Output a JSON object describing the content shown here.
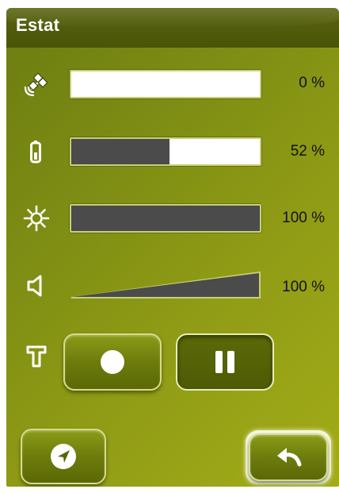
{
  "header": {
    "title": "Estat"
  },
  "rows": [
    {
      "id": "gps",
      "icon": "satellite-icon",
      "percent_label": "0 %",
      "level": 0
    },
    {
      "id": "battery",
      "icon": "battery-icon",
      "percent_label": "52 %",
      "level": 0.52
    },
    {
      "id": "brightness",
      "icon": "brightness-icon",
      "percent_label": "100 %",
      "level": 1.0
    },
    {
      "id": "volume",
      "icon": "speaker-icon",
      "percent_label": "100 %",
      "level": 1.0
    }
  ],
  "track": {
    "icon": "track-t-icon",
    "record_icon": "record-icon",
    "pause_icon": "pause-icon",
    "pause_active": true
  },
  "footer": {
    "navigate_icon": "navigation-arrow-icon",
    "back_icon": "back-arrow-icon"
  },
  "colors": {
    "background": "#8a9614",
    "header": "#4f590a",
    "bar_empty": "#ffffff",
    "bar_fill": "#4b4b4b",
    "button": "#6d7c0c",
    "button_border": "#d5dc8e"
  }
}
